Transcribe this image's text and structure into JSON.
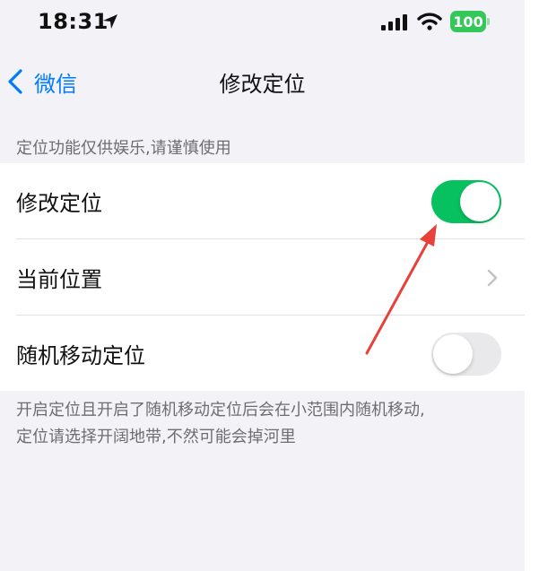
{
  "status_bar": {
    "time": "18:31",
    "battery": "100",
    "icons": [
      "location-arrow-icon",
      "cellular-signal-icon",
      "wifi-icon",
      "battery-icon"
    ]
  },
  "nav": {
    "back_label": "微信",
    "title": "修改定位"
  },
  "section": {
    "header": "定位功能仅供娱乐,请谨慎使用",
    "rows": [
      {
        "label": "修改定位",
        "control": "toggle",
        "on": true
      },
      {
        "label": "当前位置",
        "control": "chevron"
      },
      {
        "label": "随机移动定位",
        "control": "toggle",
        "on": false
      }
    ],
    "footer_line1": "开启定位且开启了随机移动定位后会在小范围内随机移动,",
    "footer_line2": "定位请选择开阔地带,不然可能会掉河里"
  },
  "colors": {
    "toggle_on": "#07c160",
    "toggle_off": "#e9e9eb",
    "link_blue": "#007aff",
    "background": "#f2f2f7",
    "annotation_red": "#e8403a",
    "battery_green": "#34c759"
  }
}
